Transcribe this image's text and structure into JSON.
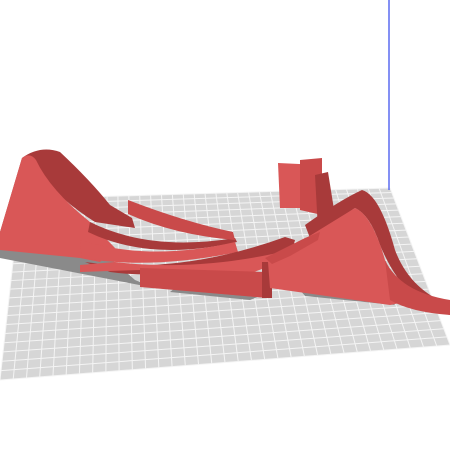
{
  "viewport": {
    "background_color": "#ffffff",
    "build_plate_color": "#d6d6d6",
    "grid_line_color": "#f4f4f4",
    "shadow_color": "#8a8a8a",
    "axis_color": "#5b6cf0",
    "model_color_light": "#d95757",
    "model_color_mid": "#c94a4a",
    "model_color_dark": "#a83a3a",
    "model_color_edge": "#7a2626"
  }
}
